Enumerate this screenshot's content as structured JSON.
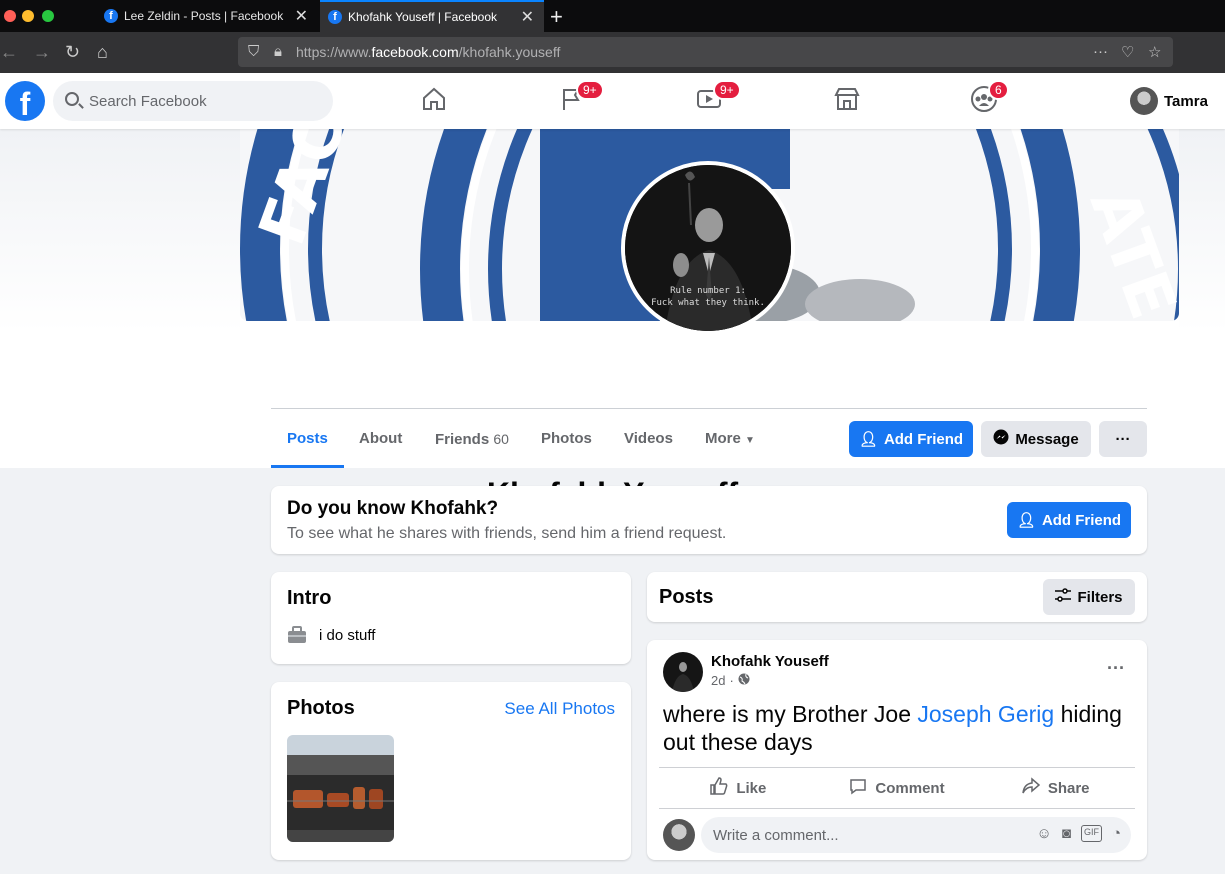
{
  "browser": {
    "tabs": [
      {
        "title": "Lee Zeldin - Posts | Facebook",
        "active": false
      },
      {
        "title": "Khofahk Youseff | Facebook",
        "active": true
      }
    ],
    "url_prefix": "https://www.",
    "url_domain": "facebook.com",
    "url_path": "/khofahk.youseff"
  },
  "header": {
    "logo": "f",
    "search_placeholder": "Search Facebook",
    "badges": {
      "pages": "9+",
      "watch": "9+",
      "groups": "6"
    },
    "user_name": "Tamra"
  },
  "profile": {
    "name": "Khofahk Youseff",
    "picture_caption_1": "Rule number 1:",
    "picture_caption_2": "Fuck what they think.",
    "tabs": {
      "posts": "Posts",
      "about": "About",
      "friends": "Friends",
      "friends_count": "60",
      "photos": "Photos",
      "videos": "Videos",
      "more": "More"
    },
    "add_friend": "Add Friend",
    "message": "Message",
    "more_dots": "···"
  },
  "know_card": {
    "title": "Do you know Khofahk?",
    "subtitle": "To see what he shares with friends, send him a friend request.",
    "button": "Add Friend"
  },
  "intro": {
    "title": "Intro",
    "items": [
      {
        "icon": "briefcase-icon",
        "text": "i do stuff"
      }
    ]
  },
  "photos_card": {
    "title": "Photos",
    "see_all": "See All Photos"
  },
  "posts_header": {
    "title": "Posts",
    "filters": "Filters"
  },
  "post": {
    "author": "Khofahk Youseff",
    "time": "2d",
    "text_before": "where is my Brother Joe ",
    "mention": "Joseph Gerig",
    "text_after": " hiding out these days",
    "like": "Like",
    "comment": "Comment",
    "share": "Share",
    "comment_placeholder": "Write a comment...",
    "menu": "···"
  },
  "colors": {
    "brand": "#1877f2",
    "badge": "#e41e3f"
  }
}
